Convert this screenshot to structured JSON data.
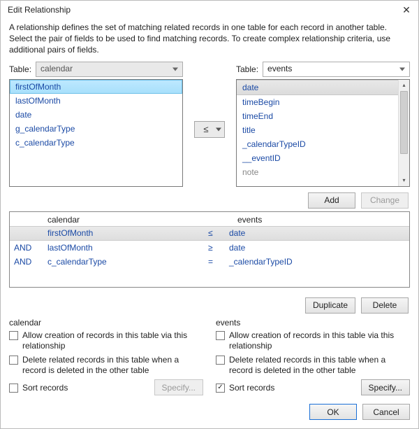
{
  "title": "Edit Relationship",
  "description": "A relationship defines the set of matching related records in one table for each record in another table. Select the pair of fields to be used to find matching records. To create complex relationship criteria, use additional pairs of fields.",
  "left": {
    "label": "Table:",
    "table": "calendar",
    "fields": [
      "firstOfMonth",
      "lastOfMonth",
      "date",
      "g_calendarType",
      "c_calendarType"
    ],
    "selected": "firstOfMonth"
  },
  "right": {
    "label": "Table:",
    "table": "events",
    "fields": [
      "date",
      "timeBegin",
      "timeEnd",
      "title",
      "_calendarTypeID",
      "__eventID",
      "note"
    ],
    "selected": "date"
  },
  "operator": "≤",
  "buttons": {
    "add": "Add",
    "change": "Change",
    "duplicate": "Duplicate",
    "delete": "Delete",
    "ok": "OK",
    "cancel": "Cancel",
    "specify": "Specify..."
  },
  "criteria": {
    "left_header": "calendar",
    "right_header": "events",
    "rows": [
      {
        "and": "",
        "f1": "firstOfMonth",
        "op": "≤",
        "f2": "date"
      },
      {
        "and": "AND",
        "f1": "lastOfMonth",
        "op": "≥",
        "f2": "date"
      },
      {
        "and": "AND",
        "f1": "c_calendarType",
        "op": "=",
        "f2": "_calendarTypeID"
      }
    ]
  },
  "opts": {
    "left_header": "calendar",
    "right_header": "events",
    "allow_create": "Allow creation of records in this table via this relationship",
    "delete_related": "Delete related records in this table when a record is deleted in the other table",
    "sort": "Sort records",
    "left_sort_checked": false,
    "right_sort_checked": true
  }
}
